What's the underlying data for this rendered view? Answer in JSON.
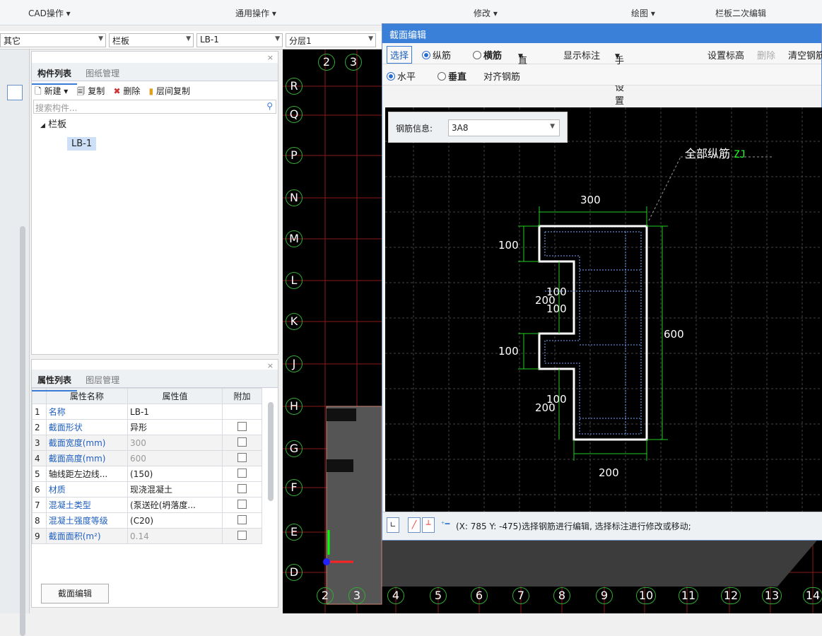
{
  "ribbon": {
    "groups": [
      "CAD操作 ▾",
      "通用操作 ▾",
      "修改 ▾",
      "绘图 ▾",
      "栏板二次编辑"
    ]
  },
  "filters": {
    "combo1": "其它",
    "combo2": "栏板",
    "combo3": "LB-1",
    "combo4": "分层1"
  },
  "component_panel": {
    "tabs": [
      "构件列表",
      "图纸管理"
    ],
    "toolbar": [
      "新建 ▾",
      "复制",
      "删除",
      "层间复制"
    ],
    "search_placeholder": "搜索构件...",
    "tree_parent": "栏板",
    "tree_child": "LB-1"
  },
  "property_panel": {
    "tabs": [
      "属性列表",
      "图层管理"
    ],
    "headers": [
      "属性名称",
      "属性值",
      "附加"
    ],
    "rows": [
      {
        "n": "1",
        "name": "名称",
        "value": "LB-1",
        "chk": false
      },
      {
        "n": "2",
        "name": "截面形状",
        "value": "异形",
        "chk": true
      },
      {
        "n": "3",
        "name": "截面宽度(mm)",
        "value": "300",
        "chk": true
      },
      {
        "n": "4",
        "name": "截面高度(mm)",
        "value": "600",
        "chk": true
      },
      {
        "n": "5",
        "name": "轴线距左边线...",
        "value": "(150)",
        "chk": true
      },
      {
        "n": "6",
        "name": "材质",
        "value": "现浇混凝土",
        "chk": true
      },
      {
        "n": "7",
        "name": "混凝土类型",
        "value": "(泵送砼(坍落度...",
        "chk": true
      },
      {
        "n": "8",
        "name": "混凝土强度等级",
        "value": "(C20)",
        "chk": true
      },
      {
        "n": "9",
        "name": "截面面积(m²)",
        "value": "0.14",
        "chk": true
      }
    ],
    "bottom_button": "截面编辑"
  },
  "cad_axes": {
    "rows": [
      "R",
      "Q",
      "P",
      "N",
      "M",
      "L",
      "K",
      "J",
      "H",
      "G",
      "F",
      "E",
      "D"
    ],
    "cols": [
      "2",
      "3",
      "4",
      "5",
      "6",
      "7",
      "8",
      "9",
      "10",
      "11",
      "12",
      "13",
      "14"
    ],
    "top_cols": [
      "2",
      "3"
    ]
  },
  "dialog": {
    "title": "截面编辑",
    "tool1": {
      "select": "选择",
      "r1": "纵筋",
      "r2": "横筋",
      "line": "直线",
      "show": "显示标注",
      "ref": "手动设置参考线",
      "elev": "设置标高",
      "del": "删除",
      "clear": "清空钢筋"
    },
    "tool2": {
      "h": "水平",
      "v": "垂直",
      "align": "对齐钢筋"
    },
    "rebar_label": "钢筋信息:",
    "rebar_value": "3A8",
    "annotation": "全部纵筋",
    "annotation_code": "ZJ",
    "dims": {
      "top": "300",
      "left1": "100",
      "mid1": "100",
      "mid2": "200",
      "mid3": "100",
      "right": "600",
      "left2": "100",
      "mid4": "100",
      "mid5": "200",
      "bottom": "200"
    },
    "status": "(X: 785 Y: -475)选择钢筋进行编辑, 选择标注进行修改或移动;"
  }
}
